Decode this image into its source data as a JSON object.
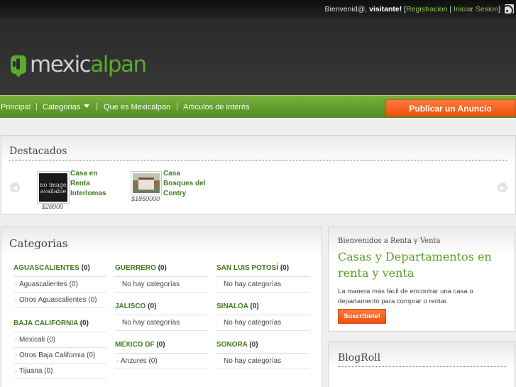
{
  "topbar": {
    "greeting": "Bienvenid@,",
    "user": "visitante!",
    "open_bracket": "[",
    "register": "Registracion",
    "divider": "|",
    "login": "Iniciar Sesion",
    "close_bracket": "]",
    "rss_icon": "rss-icon"
  },
  "logo": {
    "part1": "mexic",
    "part2": "alpan",
    "icon": "cactus-logo-icon"
  },
  "nav": {
    "items": [
      "Principal",
      "Categorias",
      "Que es Mexicalpan",
      "Articulos de interés"
    ],
    "separator": "|",
    "publish": "Publicar un Anuncio",
    "dropdown_icon": "chevron-down-icon"
  },
  "featured": {
    "title": "Destacados",
    "prev_icon": "chevron-left-icon",
    "next_icon": "chevron-right-icon",
    "items": [
      {
        "image_text": "no image available",
        "title_lines": [
          "Casa en",
          "Renta",
          "Interlomas"
        ],
        "price": "$28000"
      },
      {
        "title_lines": [
          "Casa",
          "Bosques del",
          "Contry"
        ],
        "price": "$1850000"
      }
    ]
  },
  "categories": {
    "title": "Categorias",
    "columns": [
      [
        {
          "name": "AGUASCALIENTES",
          "count": "(0)",
          "subs": [
            "Aguascalientes (0)",
            "Otros Aguascalientes (0)"
          ]
        },
        {
          "name": "BAJA CALIFORNIA",
          "count": "(0)",
          "subs": [
            "Mexicali (0)",
            "Otros Baja California (0)",
            "Tijuana (0)"
          ]
        }
      ],
      [
        {
          "name": "GUERRERO",
          "count": "(0)",
          "subs": [
            "No hay categorías"
          ]
        },
        {
          "name": "JALISCO",
          "count": "(0)",
          "subs": [
            "No hay categorías"
          ]
        },
        {
          "name": "MEXICO DF",
          "count": "(0)",
          "subs": [
            "Anzures (0)"
          ]
        }
      ],
      [
        {
          "name": "SAN LUIS POTOSÍ",
          "count": "(0)",
          "subs": [
            "No hay categorías"
          ]
        },
        {
          "name": "SINALOA",
          "count": "(0)",
          "subs": [
            "No hay categorías"
          ]
        },
        {
          "name": "SONORA",
          "count": "(0)",
          "subs": [
            "No hay categorías"
          ]
        }
      ]
    ]
  },
  "welcome": {
    "subtitle": "Bienvenidos a Renta y Venta",
    "headline": "Casas y Departamentos en renta y venta",
    "description": "La manera más fácil de encontrar una casa o departamento para comprar o rentar.",
    "button": "Suscribete!"
  },
  "blogroll": {
    "title": "BlogRoll"
  },
  "colors": {
    "brand_green": "#5aaa2f",
    "accent_orange": "#f04f10",
    "dark_header": "#2a2a2a"
  }
}
